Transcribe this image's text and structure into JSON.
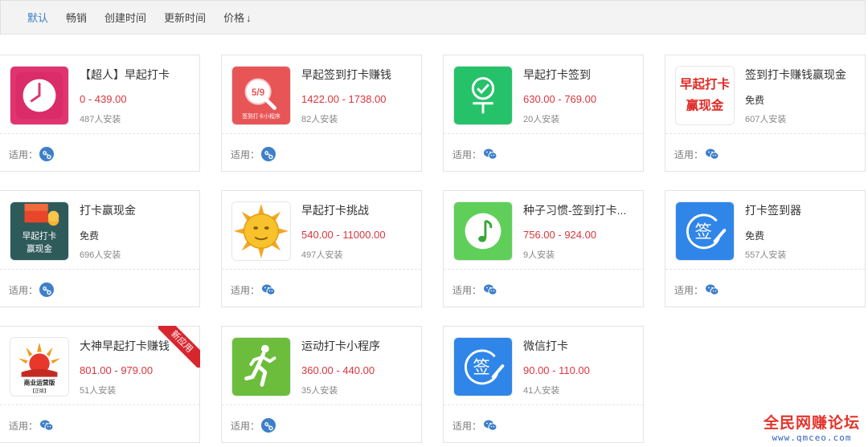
{
  "sort_bar": {
    "items": [
      "默认",
      "畅销",
      "创建时间",
      "更新时间",
      "价格"
    ],
    "active_index": 0,
    "price_arrow": "↓"
  },
  "fit_label": "适用：",
  "cards": [
    {
      "name": "【超人】早起打卡",
      "price": "0 - 439.00",
      "installs": "487人安装",
      "platform": "mini-program-icon",
      "icon": "clock-icon"
    },
    {
      "name": "早起签到打卡赚钱",
      "price": "1422.00 - 1738.00",
      "installs": "82人安装",
      "platform": "mini-program-icon",
      "icon": "calendar-search-icon",
      "icon_text": [
        "5/9",
        "签到打卡小程序"
      ]
    },
    {
      "name": "早起打卡签到",
      "price": "630.00 - 769.00",
      "installs": "20人安装",
      "platform": "wechat-icon",
      "icon": "check-person-icon"
    },
    {
      "name": "签到打卡赚钱赢现金",
      "price": "免费",
      "installs": "607人安装",
      "platform": "wechat-icon",
      "icon": "text-logo-icon",
      "icon_text": [
        "早起打卡",
        "赢现金"
      ]
    },
    {
      "name": "打卡赢现金",
      "price": "免费",
      "installs": "696人安装",
      "platform": "mini-program-icon",
      "icon": "red-envelope-icon",
      "icon_text": [
        "早起打卡",
        "赢现金"
      ]
    },
    {
      "name": "早起打卡挑战",
      "price": "540.00 - 11000.00",
      "installs": "497人安装",
      "platform": "wechat-icon",
      "icon": "sun-icon"
    },
    {
      "name": "种子习惯-签到打卡...",
      "price": "756.00 - 924.00",
      "installs": "9人安装",
      "platform": "wechat-icon",
      "icon": "music-note-icon"
    },
    {
      "name": "打卡签到器",
      "price": "免费",
      "installs": "557人安装",
      "platform": "wechat-icon",
      "icon": "sign-seal-icon",
      "icon_text": [
        "签"
      ]
    },
    {
      "name": "大神早起打卡赚钱",
      "price": "801.00 - 979.00",
      "installs": "51人安装",
      "platform": "wechat-icon",
      "icon": "sunrise-logo-icon",
      "icon_text": [
        "商业运营版",
        "【正版】"
      ],
      "ribbon": "新应用"
    },
    {
      "name": "运动打卡小程序",
      "price": "360.00 - 440.00",
      "installs": "35人安装",
      "platform": "mini-program-icon",
      "icon": "runner-icon"
    },
    {
      "name": "微信打卡",
      "price": "90.00 - 110.00",
      "installs": "41人安装",
      "platform": "wechat-icon",
      "icon": "sign-seal-icon",
      "icon_text": [
        "签"
      ]
    }
  ],
  "watermark": {
    "title": "全民网赚论坛",
    "url": "www.qmceo.com"
  },
  "colors": {
    "price": "#d9363e",
    "active_sort": "#3b7dc4",
    "platform_blue": "#3d7fc9",
    "ribbon": "#d8262f"
  }
}
